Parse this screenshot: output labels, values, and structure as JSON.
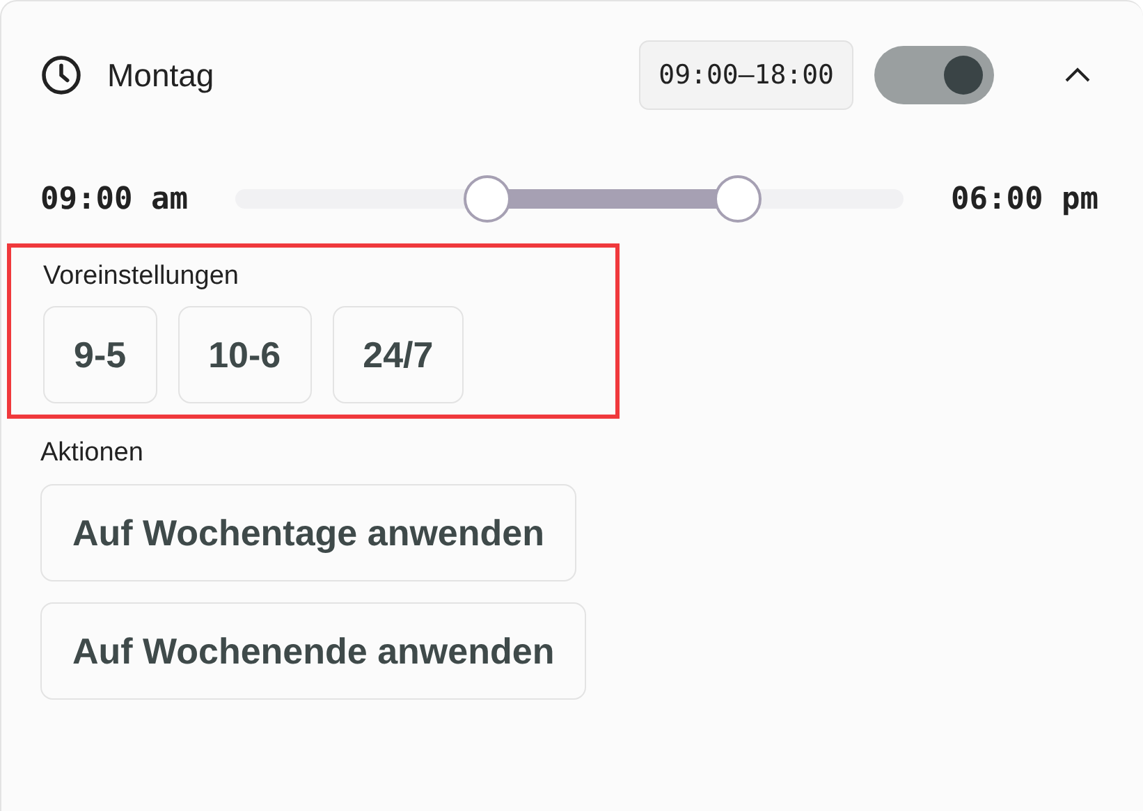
{
  "day": {
    "title": "Montag",
    "range_badge": "09:00–18:00",
    "enabled": true,
    "expanded": true
  },
  "slider": {
    "start_label": "09:00 am",
    "end_label": "06:00 pm",
    "thumbs": [
      {
        "level": 0.375
      },
      {
        "level": 0.75
      }
    ]
  },
  "presets": {
    "label": "Voreinstellungen",
    "highlighted": true,
    "buttons": [
      "9-5",
      "10-6",
      "24/7"
    ]
  },
  "actions": {
    "label": "Aktionen",
    "buttons": [
      "Auf Wochentage anwenden",
      "Auf Wochenende anwenden"
    ]
  }
}
